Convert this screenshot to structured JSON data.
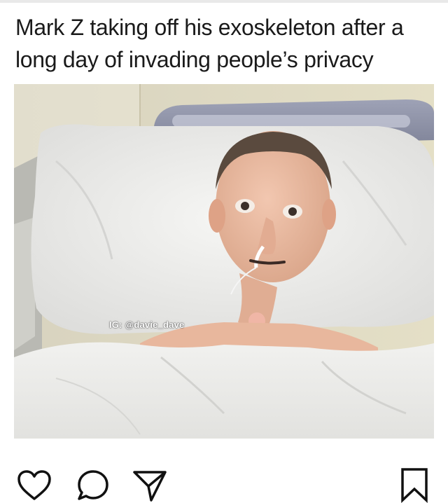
{
  "post": {
    "caption": "Mark Z taking off his exoskeleton after a long day of invading people’s privacy",
    "watermark": "IG: @davie_dave"
  },
  "actions": {
    "icons": [
      "heart-icon",
      "comment-icon",
      "share-icon",
      "bookmark-icon"
    ]
  }
}
